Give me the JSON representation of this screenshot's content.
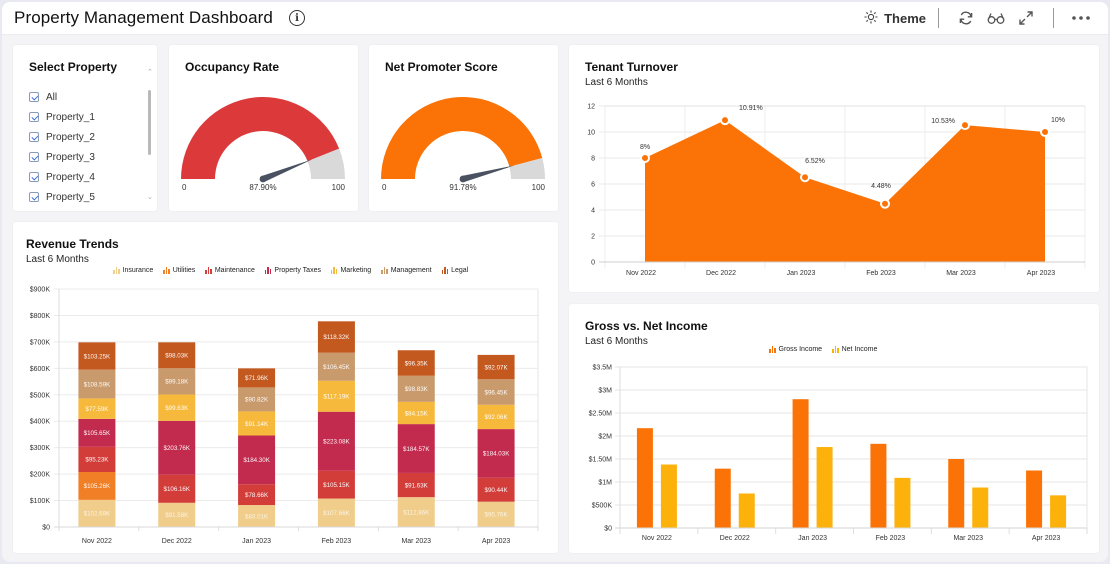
{
  "header": {
    "title": "Property Management Dashboard",
    "info_icon": "info-icon",
    "theme_label": "Theme",
    "icons": [
      "sun-icon",
      "refresh-icon",
      "glasses-icon",
      "expand-icon",
      "more-icon"
    ]
  },
  "select_property": {
    "title": "Select Property",
    "items": [
      {
        "label": "All",
        "checked": true
      },
      {
        "label": "Property_1",
        "checked": true
      },
      {
        "label": "Property_2",
        "checked": true
      },
      {
        "label": "Property_3",
        "checked": true
      },
      {
        "label": "Property_4",
        "checked": true
      },
      {
        "label": "Property_5",
        "checked": true
      }
    ]
  },
  "gauges": [
    {
      "title": "Occupancy Rate",
      "value": 87.9,
      "value_label": "87.90%",
      "min": "0",
      "max": "100",
      "color": "#dc3a3a",
      "track": "#d9d9d9"
    },
    {
      "title": "Net Promoter Score",
      "value": 91.78,
      "value_label": "91.78%",
      "min": "0",
      "max": "100",
      "color": "#fb7306",
      "track": "#d9d9d9"
    }
  ],
  "chart_data": [
    {
      "id": "tenant-turnover",
      "type": "area",
      "title": "Tenant Turnover",
      "subtitle": "Last 6 Months",
      "categories": [
        "Nov 2022",
        "Dec 2022",
        "Jan 2023",
        "Feb 2023",
        "Mar 2023",
        "Apr 2023"
      ],
      "values": [
        8,
        10.91,
        6.52,
        4.48,
        10.53,
        10
      ],
      "labels": [
        "8%",
        "10.91%",
        "6.52%",
        "4.48%",
        "10.53%",
        "10%"
      ],
      "yticks": [
        "0",
        "2",
        "4",
        "6",
        "8",
        "10",
        "12"
      ],
      "ylim": [
        0,
        12
      ],
      "grid": true,
      "color": "#fb7306"
    },
    {
      "id": "revenue-trends",
      "type": "bar",
      "stacked": true,
      "title": "Revenue Trends",
      "subtitle": "Last 6 Months",
      "legend_position": "top",
      "categories": [
        "Nov 2022",
        "Dec 2022",
        "Jan 2023",
        "Feb 2023",
        "Mar 2023",
        "Apr 2023"
      ],
      "yticks": [
        "$0",
        "$100K",
        "$200K",
        "$300K",
        "$400K",
        "$500K",
        "$600K",
        "$700K",
        "$800K",
        "$900K"
      ],
      "ylim": [
        0,
        900
      ],
      "series": [
        {
          "name": "Insurance",
          "color": "#f0cd8a",
          "values": [
            102.69,
            91.58,
            83.01,
            107.66,
            112.86,
            95.76
          ],
          "labels": [
            "$102.69K",
            "$91.58K",
            "$83.01K",
            "$107.66K",
            "$112.86K",
            "$95.76K"
          ]
        },
        {
          "name": "Utilities",
          "color": "#f07f25",
          "values": [
            105.26,
            0,
            0,
            0,
            0,
            0
          ],
          "labels": [
            "$105.26K",
            "",
            "",
            "",
            "",
            ""
          ]
        },
        {
          "name": "Maintenance",
          "color": "#d23d3a",
          "values": [
            95.23,
            106.16,
            78.66,
            105.15,
            91.63,
            90.44
          ],
          "labels": [
            "$95.23K",
            "$106.16K",
            "$78.66K",
            "$105.15K",
            "$91.63K",
            "$90.44K"
          ]
        },
        {
          "name": "Property Taxes",
          "color": "#c22a4e",
          "values": [
            105.65,
            203.76,
            184.3,
            223.08,
            184.57,
            184.03
          ],
          "labels": [
            "$105.65K",
            "$203.76K",
            "$184.30K",
            "$223.08K",
            "$184.57K",
            "$184.03K"
          ]
        },
        {
          "name": "Marketing",
          "color": "#f6b93b",
          "values": [
            77.59,
            99.63,
            91.14,
            117.19,
            84.15,
            92.06
          ],
          "labels": [
            "$77.59K",
            "$99.63K",
            "$91.14K",
            "$117.19K",
            "$84.15K",
            "$92.06K"
          ]
        },
        {
          "name": "Management",
          "color": "#c99a6b",
          "values": [
            108.59,
            99.18,
            90.82,
            106.45,
            98.83,
            96.45
          ],
          "labels": [
            "$108.59K",
            "$99.18K",
            "$90.82K",
            "$106.45K",
            "$98.83K",
            "$96.45K"
          ]
        },
        {
          "name": "Legal",
          "color": "#c4591f",
          "values": [
            103.25,
            98.03,
            71.96,
            118.32,
            96.35,
            92.07
          ],
          "labels": [
            "$103.25K",
            "$98.03K",
            "$71.96K",
            "$118.32K",
            "$96.35K",
            "$92.07K"
          ]
        }
      ]
    },
    {
      "id": "gross-vs-net",
      "type": "bar",
      "title": "Gross vs. Net Income",
      "subtitle": "Last 6 Months",
      "legend_position": "top",
      "categories": [
        "Nov 2022",
        "Dec 2022",
        "Jan 2023",
        "Feb 2023",
        "Mar 2023",
        "Apr 2023"
      ],
      "yticks": [
        "$0",
        "$500K",
        "$1M",
        "$1.50M",
        "$2M",
        "$2.50M",
        "$3M",
        "$3.5M"
      ],
      "ylim": [
        0,
        3.5
      ],
      "series": [
        {
          "name": "Gross Income",
          "color": "#fb7306",
          "values": [
            2.17,
            1.29,
            2.8,
            1.83,
            1.5,
            1.25
          ]
        },
        {
          "name": "Net Income",
          "color": "#fcb20a",
          "values": [
            1.38,
            0.75,
            1.76,
            1.09,
            0.88,
            0.71
          ]
        }
      ]
    }
  ]
}
